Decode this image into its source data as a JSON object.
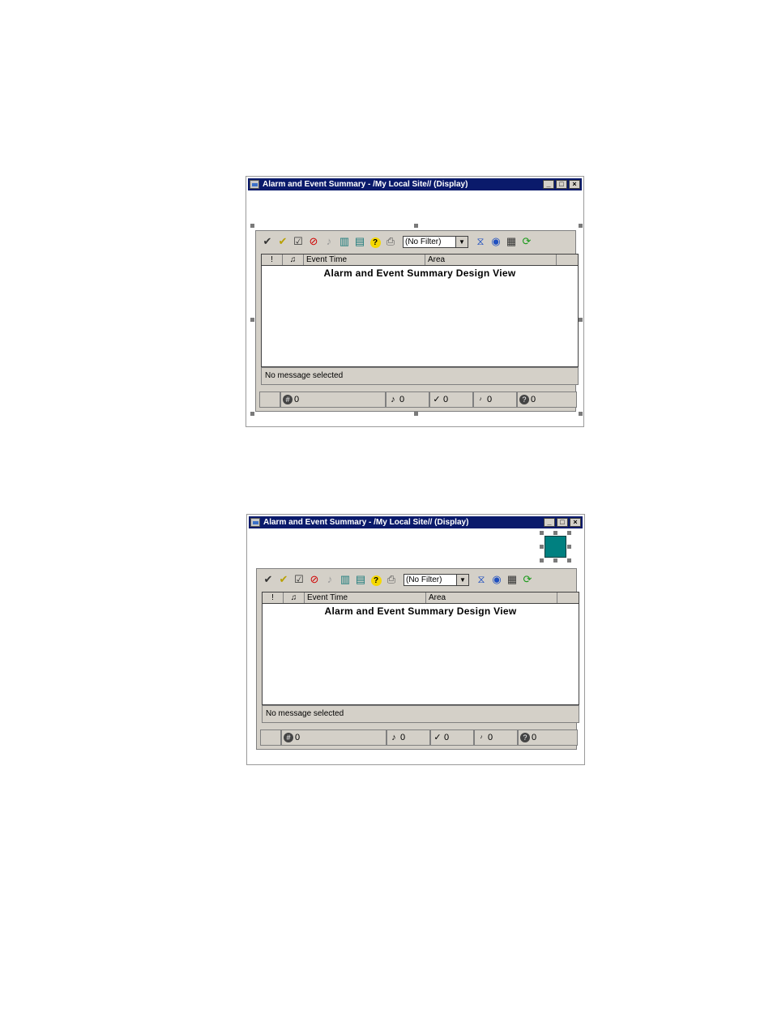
{
  "windows": [
    {
      "title": "Alarm and Event Summary - /My Local Site// (Display)",
      "filter_value": "(No Filter)",
      "columns": [
        "Event Time",
        "Area"
      ],
      "design_label": "Alarm and Event Summary Design View",
      "message": "No message selected",
      "counts": {
        "total": "0",
        "alarms": "0",
        "acked": "0",
        "low": "0",
        "unknown": "0"
      }
    },
    {
      "title": "Alarm and Event Summary - /My Local Site// (Display)",
      "filter_value": "(No Filter)",
      "columns": [
        "Event Time",
        "Area"
      ],
      "design_label": "Alarm and Event Summary Design View",
      "message": "No message selected",
      "counts": {
        "total": "0",
        "alarms": "0",
        "acked": "0",
        "low": "0",
        "unknown": "0"
      }
    }
  ],
  "colors": {
    "titlebar": "#0a1a6b",
    "control_bg": "#d4d0c8",
    "selected_object": "#008080"
  },
  "icons": {
    "toolbar": [
      "acknowledge-icon",
      "acknowledge-page-icon",
      "acknowledge-all-icon",
      "suppress-icon",
      "silence-icon",
      "sort-icon",
      "properties-icon",
      "help-icon",
      "print-icon"
    ],
    "toolbar_right": [
      "clear-filter-icon",
      "find-icon",
      "details-icon",
      "refresh-icon"
    ]
  }
}
